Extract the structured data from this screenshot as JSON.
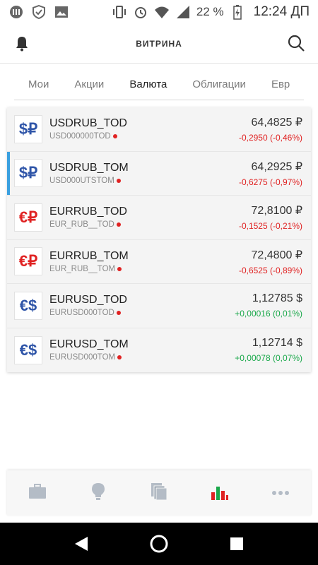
{
  "status_bar": {
    "battery_percent": "22 %",
    "time": "12:24 ДП"
  },
  "header": {
    "title": "ВИТРИНА"
  },
  "tabs": [
    {
      "label": "Мои",
      "active": false
    },
    {
      "label": "Акции",
      "active": false
    },
    {
      "label": "Валюта",
      "active": true
    },
    {
      "label": "Облигации",
      "active": false
    },
    {
      "label": "Евр",
      "active": false
    }
  ],
  "instruments": [
    {
      "icon": "usd-rub-icon",
      "icon_text": "$₽",
      "ticker": "USDRUB_TOD",
      "code": "USD000000TOD",
      "price": "64,4825 ₽",
      "change": "-0,2950 (-0,46%)",
      "direction": "neg",
      "selected": false
    },
    {
      "icon": "usd-rub-icon",
      "icon_text": "$₽",
      "ticker": "USDRUB_TOM",
      "code": "USD000UTSTOM",
      "price": "64,2925 ₽",
      "change": "-0,6275 (-0,97%)",
      "direction": "neg",
      "selected": true
    },
    {
      "icon": "eur-rub-icon",
      "icon_text": "€₽",
      "ticker": "EURRUB_TOD",
      "code": "EUR_RUB__TOD",
      "price": "72,8100 ₽",
      "change": "-0,1525 (-0,21%)",
      "direction": "neg",
      "selected": false
    },
    {
      "icon": "eur-rub-icon",
      "icon_text": "€₽",
      "ticker": "EURRUB_TOM",
      "code": "EUR_RUB__TOM",
      "price": "72,4800 ₽",
      "change": "-0,6525 (-0,89%)",
      "direction": "neg",
      "selected": false
    },
    {
      "icon": "eur-usd-icon",
      "icon_text": "€$",
      "ticker": "EURUSD_TOD",
      "code": "EURUSD000TOD",
      "price": "1,12785 $",
      "change": "+0,00016 (0,01%)",
      "direction": "pos",
      "selected": false
    },
    {
      "icon": "eur-usd-icon",
      "icon_text": "€$",
      "ticker": "EURUSD_TOM",
      "code": "EURUSD000TOM",
      "price": "1,12714 $",
      "change": "+0,00078 (0,07%)",
      "direction": "pos",
      "selected": false
    }
  ],
  "bottom_nav": [
    {
      "icon": "briefcase-icon"
    },
    {
      "icon": "lightbulb-icon"
    },
    {
      "icon": "documents-icon"
    },
    {
      "icon": "bar-chart-icon",
      "active": true
    },
    {
      "icon": "more-icon"
    }
  ],
  "colors": {
    "negative": "#e02222",
    "positive": "#1aa84a",
    "selected_indicator": "#3aa0e0",
    "usd_icon": "#2f55a8",
    "eur_icon": "#e02222"
  }
}
